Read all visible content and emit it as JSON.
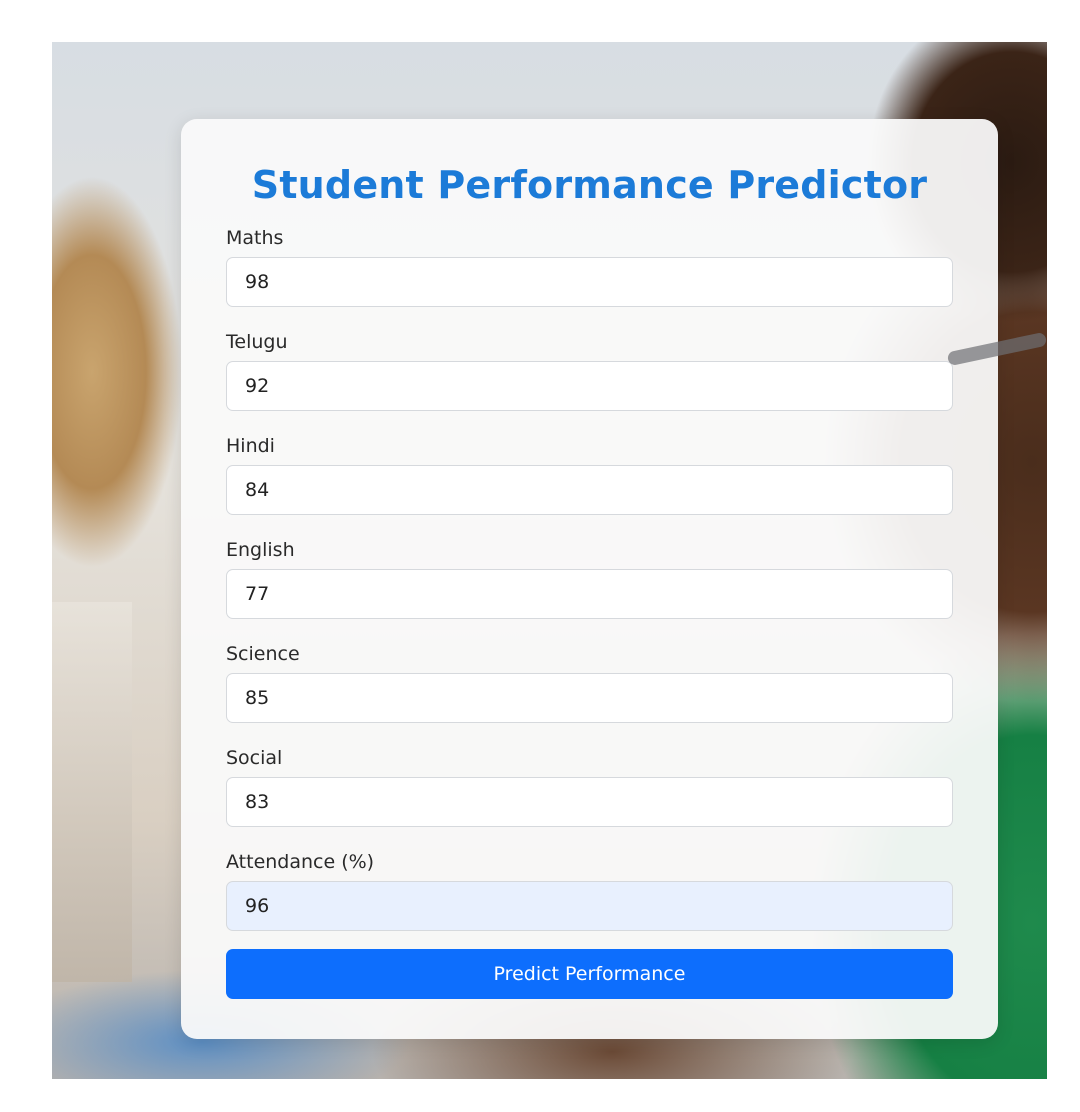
{
  "form": {
    "title": "Student Performance Predictor",
    "fields": [
      {
        "label": "Maths",
        "value": "98"
      },
      {
        "label": "Telugu",
        "value": "92"
      },
      {
        "label": "Hindi",
        "value": "84"
      },
      {
        "label": "English",
        "value": "77"
      },
      {
        "label": "Science",
        "value": "85"
      },
      {
        "label": "Social",
        "value": "83"
      },
      {
        "label": "Attendance (%)",
        "value": "96"
      }
    ],
    "submit_label": "Predict Performance"
  },
  "colors": {
    "title": "#1c7bd8",
    "button": "#0d6efd",
    "autofill": "#e8f0fe"
  }
}
